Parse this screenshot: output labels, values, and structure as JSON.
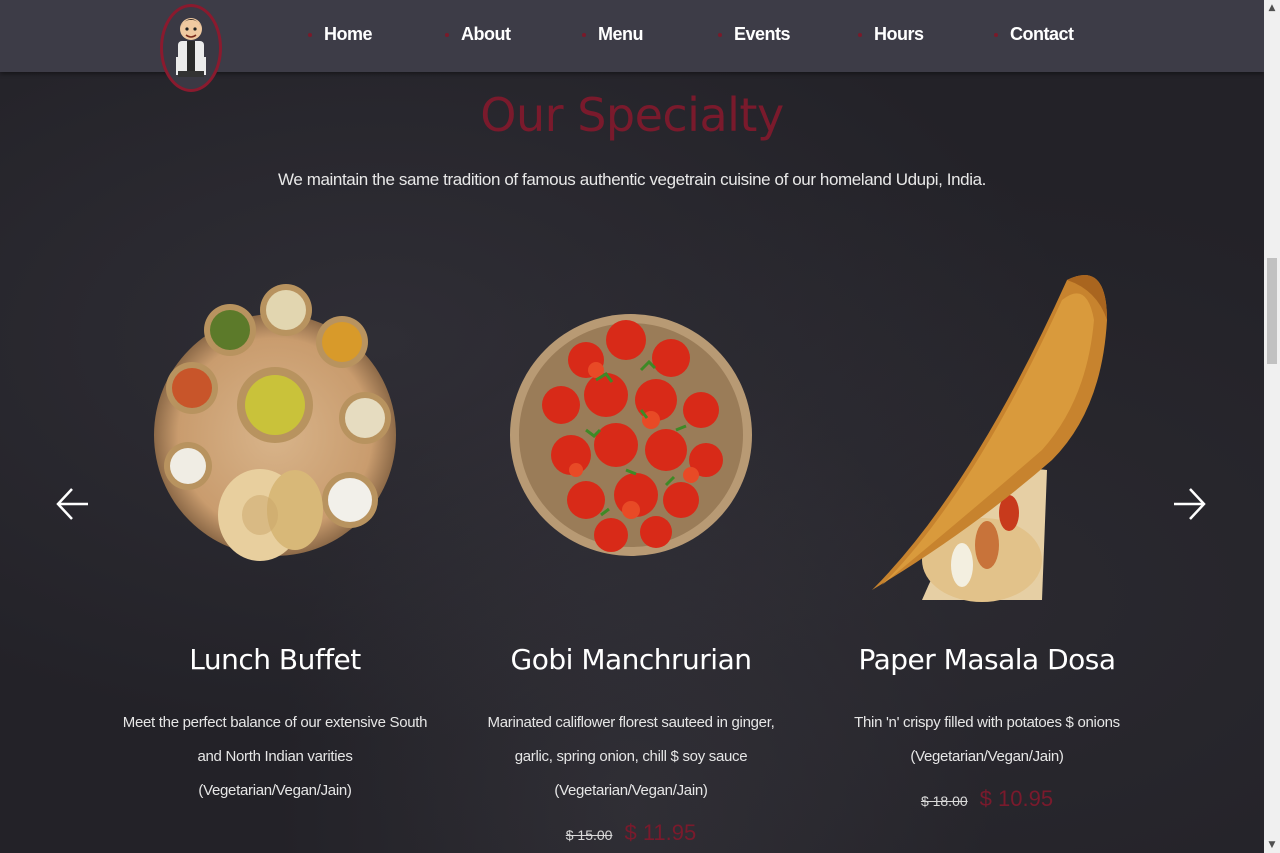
{
  "nav": {
    "logo_icon": "chef-mascot-logo",
    "items": [
      {
        "label": "Home"
      },
      {
        "label": "About"
      },
      {
        "label": "Menu"
      },
      {
        "label": "Events"
      },
      {
        "label": "Hours"
      },
      {
        "label": "Contact"
      }
    ]
  },
  "specialty": {
    "title": "Our Specialty",
    "subtitle": "We maintain the same tradition of famous authentic vegetrain cuisine of our homeland Udupi, India."
  },
  "carousel": {
    "prev_icon": "arrow-left-icon",
    "next_icon": "arrow-right-icon",
    "cards": [
      {
        "title": "Lunch Buffet",
        "desc_lines": [
          "Meet the perfect balance of our extensive South",
          "and North Indian varities",
          "(Vegetarian/Vegan/Jain)"
        ],
        "image": "thali-plate-image",
        "price_old": "",
        "price_new": ""
      },
      {
        "title": "Gobi Manchrurian",
        "desc_lines": [
          "Marinated califlower florest sauteed in ginger,",
          "garlic, spring onion, chill $ soy sauce",
          "(Vegetarian/Vegan/Jain)"
        ],
        "image": "gobi-manchurian-image",
        "price_old": "$ 15.00",
        "price_new": "$ 11.95"
      },
      {
        "title": "Paper Masala Dosa",
        "desc_lines": [
          "Thin 'n' crispy filled with potatoes $ onions",
          "(Vegetarian/Vegan/Jain)"
        ],
        "image": "paper-dosa-image",
        "price_old": "$ 18.00",
        "price_new": "$ 10.95"
      }
    ]
  },
  "colors": {
    "accent": "#7a1a2c",
    "navbar": "#3d3c47",
    "background": "#232228"
  }
}
